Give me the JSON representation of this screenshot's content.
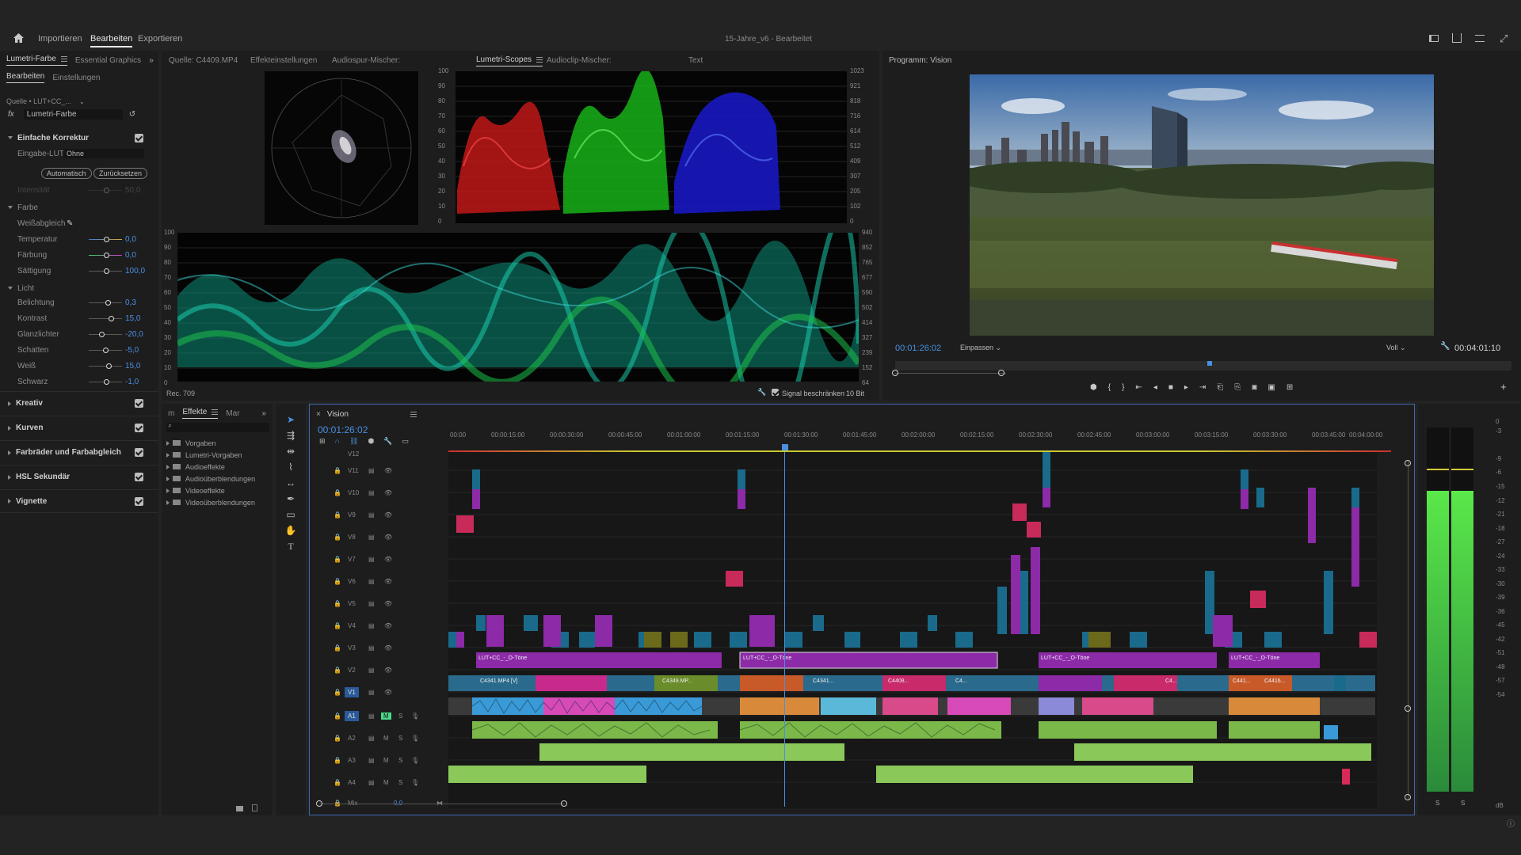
{
  "app": {
    "menu": [
      "Importieren",
      "Bearbeiten",
      "Exportieren"
    ],
    "active_menu": "Bearbeiten",
    "title": "15-Jahre_v6",
    "subtitle": "Bearbeitet"
  },
  "lumetri": {
    "tabs": [
      "Lumetri-Farbe",
      "Essential Graphics"
    ],
    "subtabs": [
      "Bearbeiten",
      "Einstellungen"
    ],
    "source": "Quelle • LUT+CC_...",
    "fx_label": "Lumetri-Farbe",
    "basic_title": "Einfache Korrektur",
    "input_lut_label": "Eingabe-LUT",
    "input_lut_value": "Ohne",
    "auto": "Automatisch",
    "reset": "Zurücksetzen",
    "intensity_label": "Intensität",
    "intensity_val": "50,0",
    "color_title": "Farbe",
    "wb_label": "Weißabgleich",
    "temp_label": "Temperatur",
    "temp_val": "0,0",
    "tint_label": "Färbung",
    "tint_val": "0,0",
    "sat_label": "Sättigung",
    "sat_val": "100,0",
    "light_title": "Licht",
    "exposure_label": "Belichtung",
    "exposure_val": "0,3",
    "contrast_label": "Kontrast",
    "contrast_val": "15,0",
    "highlights_label": "Glanzlichter",
    "highlights_val": "-20,0",
    "shadows_label": "Schatten",
    "shadows_val": "-5,0",
    "white_label": "Weiß",
    "white_val": "15,0",
    "black_label": "Schwarz",
    "black_val": "-1,0",
    "sections": [
      "Kreativ",
      "Kurven",
      "Farbräder und Farbabgleich",
      "HSL Sekundär",
      "Vignette"
    ]
  },
  "source_panel": {
    "tabs": [
      "Quelle: C4409.MP4",
      "Effekteinstellungen",
      "Audiospur-Mischer:",
      "Lumetri-Scopes",
      "Audioclip-Mischer:",
      "Text"
    ],
    "active": "Lumetri-Scopes"
  },
  "scopes": {
    "rgb_left": [
      "100",
      "90",
      "80",
      "70",
      "60",
      "50",
      "40",
      "30",
      "20",
      "10",
      "0"
    ],
    "rgb_right": [
      "1023",
      "921",
      "818",
      "716",
      "614",
      "512",
      "409",
      "307",
      "205",
      "102",
      "0"
    ],
    "wave_left": [
      "100",
      "90",
      "80",
      "70",
      "60",
      "50",
      "40",
      "30",
      "20",
      "10",
      "0"
    ],
    "wave_right": [
      "940",
      "852",
      "765",
      "677",
      "590",
      "502",
      "414",
      "327",
      "239",
      "152",
      "64"
    ],
    "rec": "Rec. 709",
    "clamp": "Signal beschränken",
    "bits": "10 Bit"
  },
  "program": {
    "title": "Programm: Vision",
    "timecode": "00:01:26:02",
    "fit": "Einpassen",
    "quality": "Voll",
    "duration": "00:04:01:10"
  },
  "effects_panel": {
    "tabs": [
      "m",
      "Effekte",
      "Mar"
    ],
    "folders": [
      "Vorgaben",
      "Lumetri-Vorgaben",
      "Audioeffekte",
      "Audioüberblendungen",
      "Videoeffekte",
      "Videoüberblendungen"
    ]
  },
  "timeline": {
    "name": "Vision",
    "timecode": "00:01:26:02",
    "ruler": [
      "00:00",
      "00:00:15:00",
      "00:00:30:00",
      "00:00:45:00",
      "00:01:00:00",
      "00:01:15:00",
      "00:01:30:00",
      "00:01:45:00",
      "00:02:00:00",
      "00:02:15:00",
      "00:02:30:00",
      "00:02:45:00",
      "00:03:00:00",
      "00:03:15:00",
      "00:03:30:00",
      "00:03:45:00",
      "00:04:00:00"
    ],
    "video_tracks": [
      "V12",
      "V11",
      "V10",
      "V9",
      "V8",
      "V7",
      "V6",
      "V5",
      "V4",
      "V3",
      "V2",
      "V1"
    ],
    "audio_tracks": [
      "A1",
      "A2",
      "A3",
      "A4"
    ],
    "mix_label": "Mix",
    "mix_val": "0,0",
    "clip_labels": [
      "LUT+CC_-_O-Töne",
      "LUT+CC_-_O-Töne",
      "LUT+CC_-_O-Töne",
      "LUT+CC_-_O-Töne",
      "C4341.MP4 [V]",
      "C4349.MP...",
      "C4341...",
      "C4408...",
      "C4...",
      "C4...",
      "C441...",
      "C4416..."
    ],
    "meter_labels": [
      "S",
      "S"
    ],
    "meter_scale": [
      "0",
      "-6",
      "-12",
      "-18",
      "-24",
      "-30",
      "-36",
      "-42",
      "-48",
      "-54",
      "dB"
    ],
    "meter_scale2": [
      "-3",
      "-9",
      "-15",
      "-21",
      "-27",
      "-33",
      "-39",
      "-45",
      "-51",
      "-57"
    ]
  },
  "colors": {
    "accent": "#4a8fe0",
    "bg": "#1d1d1d",
    "frame": "#232323"
  }
}
